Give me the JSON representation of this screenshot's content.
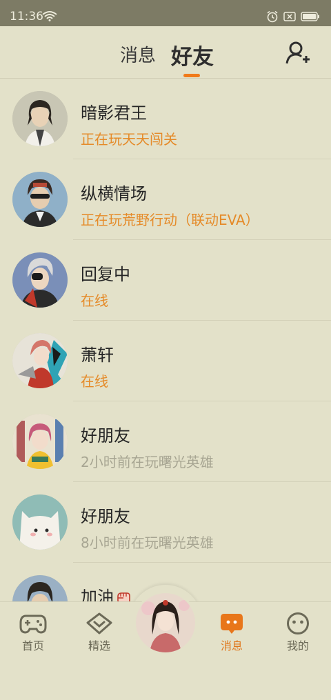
{
  "status_bar": {
    "time": "11:36"
  },
  "header": {
    "tabs": [
      {
        "label": "消息",
        "active": false
      },
      {
        "label": "好友",
        "active": true
      }
    ],
    "add_friend_icon": "add-user-icon"
  },
  "friends": [
    {
      "name": "暗影君王",
      "status": "正在玩天天闯关",
      "online": true
    },
    {
      "name": "纵横情场",
      "status": "正在玩荒野行动（联动EVA）",
      "online": true
    },
    {
      "name": "回复中",
      "status": "在线",
      "online": true
    },
    {
      "name": "萧轩",
      "status": "在线",
      "online": true
    },
    {
      "name": "好朋友",
      "status": "2小时前在玩曙光英雄",
      "online": false
    },
    {
      "name": "好朋友",
      "status": "8小时前在玩曙光英雄",
      "online": false
    },
    {
      "name": "加油",
      "status": "",
      "online": false
    }
  ],
  "bottom_nav": {
    "items": [
      {
        "label": "首页",
        "icon": "gamepad-icon",
        "active": false
      },
      {
        "label": "精选",
        "icon": "heart-diamond-icon",
        "active": false
      },
      {
        "label": "消息",
        "icon": "chat-bubble-icon",
        "active": true
      },
      {
        "label": "我的",
        "icon": "smiley-face-icon",
        "active": false
      }
    ]
  },
  "colors": {
    "background": "#e3e1c9",
    "accent": "#f07a1a",
    "online_status": "#e58a28",
    "offline_status": "#a7a592"
  }
}
